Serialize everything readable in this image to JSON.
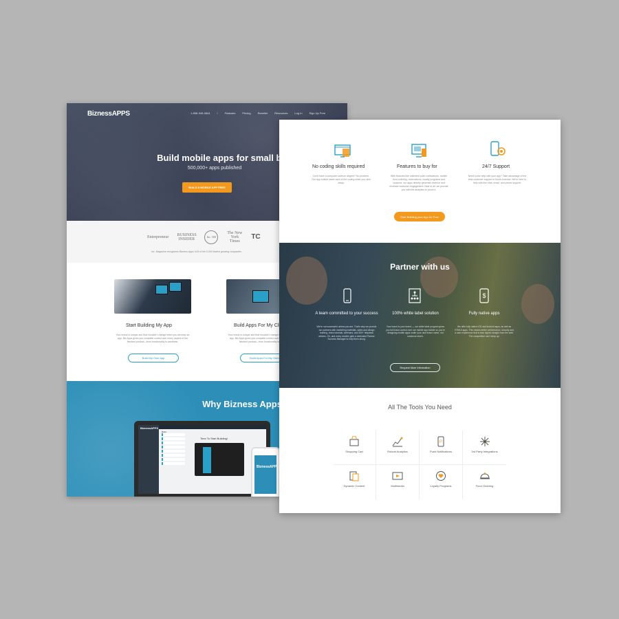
{
  "back_page": {
    "logo": "BiznessAPPS",
    "nav": [
      "1-858-345-0844",
      "/",
      "Features",
      "Pricing",
      "Reseller",
      "Resources",
      "Log In",
      "Sign Up Free"
    ],
    "hero_title": "Build mobile apps for small business",
    "hero_sub": "500,000+ apps published",
    "hero_button": "BUILD A MOBILE APP FREE",
    "press_logos": [
      "Entrepreneur",
      "BUSINESS INSIDER",
      "Inc. 500",
      "The New York Times",
      "TC"
    ],
    "press_caption": "Inc. Magazine recognizes Bizness Apps' #19 of the 5,000 fastest growing companies",
    "cards": [
      {
        "title": "Start Building My App",
        "text": "Your brand is unique and that shouldn't change when you develop an app. Biz Apps gives you complete control over every aspect of the finished product—from functionality to aesthetic.",
        "button": "Build My Own App"
      },
      {
        "title": "Build Apps For My Clients",
        "text": "Your brand is unique and that shouldn't change when you develop an app. Biz Apps gives you complete control over every aspect of the finished product—from functionality to aesthetic.",
        "button": "Build Apps For My Clients"
      }
    ],
    "why_title": "Why Bizness Apps?",
    "laptop": {
      "side_title": "BiznessAPPS",
      "heading": "Time To Start Building!",
      "section": "Build"
    }
  },
  "front_page": {
    "features": [
      {
        "title": "No coding skills required",
        "text": "Don't have a computer science degree? No problem. Our app builder takes care of the coding while you click away."
      },
      {
        "title": "Features to buy for",
        "text": "With features like unlimited push notifications, mobile food ordering, reservations, loyalty programs and coupons, our apps directly generate revenue and increase customer engagement. Best of all, we provide you with the analytics to prove it."
      },
      {
        "title": "24/7 Support",
        "text": "Need some help with your app? Take advantage of the best customer support in North America. We're here to help with live chat, email, and phone support."
      }
    ],
    "feature_button": "Start Building your App for Free",
    "partner_title": "Partner with us",
    "partner_items": [
      {
        "title": "A team committed to your success",
        "text": "We're not successful unless you are. That's why we provide our partners with marketing materials, sales and design training, video tutorials, webinars, and 300+ helpdesk articles. Oh, and every reseller gets a dedicated Partner Success Manager to help them along."
      },
      {
        "title": "100% white label solution",
        "text": "Your brand is your brand — our white label program gives you full brand control over our mobile app builder so you're designing mobile apps under your own brand name, not someone else's."
      },
      {
        "title": "Fully native apps",
        "text": "We offer fully native iOS and Android apps, as well as HTML5 apps. This means better performance, security and a user experience that is less ripped-straight from the web. The competition can't keep up."
      }
    ],
    "partner_button": "Request More Information",
    "tools_title": "All The Tools You Need",
    "tools": [
      "Shopping Cart",
      "Robust Analytics",
      "Push Notifications",
      "3rd Party Integrations",
      "Dynamic Content",
      "Multimedia",
      "Loyalty Programs",
      "Food Ordering"
    ]
  },
  "colors": {
    "accent_blue": "#2aa0c9",
    "accent_orange": "#f39a1e",
    "why_blue": "#2d8fb8",
    "background": "#b5b5b5"
  },
  "icons": [
    "code-icon",
    "desktop-icon",
    "support-gear-icon",
    "phone-icon",
    "hierarchy-icon",
    "dollar-phone-icon",
    "cart-icon",
    "chart-icon",
    "push-icon",
    "network-icon",
    "content-icon",
    "media-icon",
    "heart-icon",
    "cloche-icon"
  ]
}
